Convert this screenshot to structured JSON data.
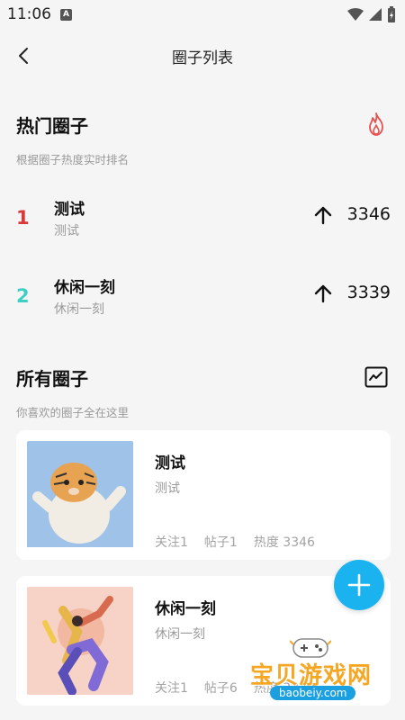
{
  "status_bar": {
    "time": "11:06",
    "notif_letter": "A"
  },
  "nav": {
    "title": "圈子列表"
  },
  "hot": {
    "title": "热门圈子",
    "subtitle": "根据圈子热度实时排名",
    "items": [
      {
        "rank": "1",
        "name": "测试",
        "desc": "测试",
        "score": "3346",
        "color": "#d9393b"
      },
      {
        "rank": "2",
        "name": "休闲一刻",
        "desc": "休闲一刻",
        "score": "3339",
        "color": "#3ecfc4"
      }
    ]
  },
  "all": {
    "title": "所有圈子",
    "subtitle": "你喜欢的圈子全在这里",
    "cards": [
      {
        "name": "测试",
        "desc": "测试",
        "follow": "关注1",
        "posts": "帖子1",
        "heat": "热度 3346"
      },
      {
        "name": "休闲一刻",
        "desc": "休闲一刻",
        "follow": "关注1",
        "posts": "帖子6",
        "heat": "热度 3339"
      }
    ]
  },
  "watermark": {
    "text": "宝贝游戏网",
    "url": "baobeiy.com"
  },
  "colors": {
    "accent": "#1ab3f0",
    "fire": "#e8504d"
  }
}
